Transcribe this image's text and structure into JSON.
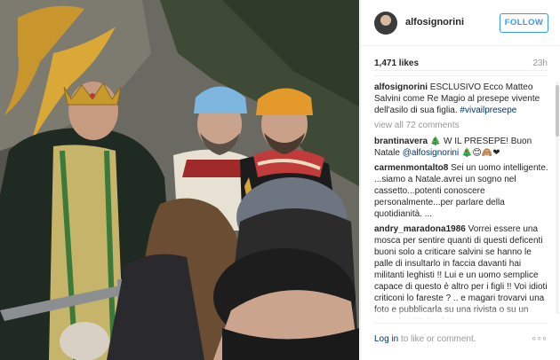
{
  "post": {
    "username": "alfosignorini",
    "follow_label": "FOLLOW",
    "likes": "1,471 likes",
    "time": "23h"
  },
  "caption": {
    "username": "alfosignorini",
    "text": " ESCLUSIVO Ecco Matteo Salvini come Re Magio al presepe vivente dell'asilo di sua figlia. ",
    "hashtag": "#vivailpresepe"
  },
  "view_all": "view all 72 comments",
  "comments": [
    {
      "username": "brantinavera",
      "text_before": " 🎄 W IL PRESEPE! Buon Natale ",
      "mention": "@alfosignorini",
      "text_after": " 🎄😊🙈❤"
    },
    {
      "username": "carmenmontalto8",
      "text": " Sei un uomo intelligente. ...siamo a Natale.avrei un sogno nel cassetto...potenti conoscere personalmente...per parlare della quotidianità. ..."
    },
    {
      "username": "andry_maradona1986",
      "text": " Vorrei essere una mosca per sentire quanti di questi deficenti buoni solo a criticare salvini se hanno le palle di insultarlo in faccia davanti hai militanti leghisti !! Lui e un uomo semplice capace di questo è altro per i figli !! Voi idioti criticoni lo fareste ? .. e magari trovarvi una foto e pubblicarla su una rivista o su un giornale intitolandola"
    }
  ],
  "footer": {
    "login_link": "Log in",
    "login_rest": " to like or comment.",
    "more": "◦◦◦"
  },
  "colors": {
    "accent": "#3897f0",
    "link": "#003569",
    "muted": "#999999"
  },
  "icons": {
    "avatar": "profile-avatar",
    "more": "more-options-icon"
  }
}
